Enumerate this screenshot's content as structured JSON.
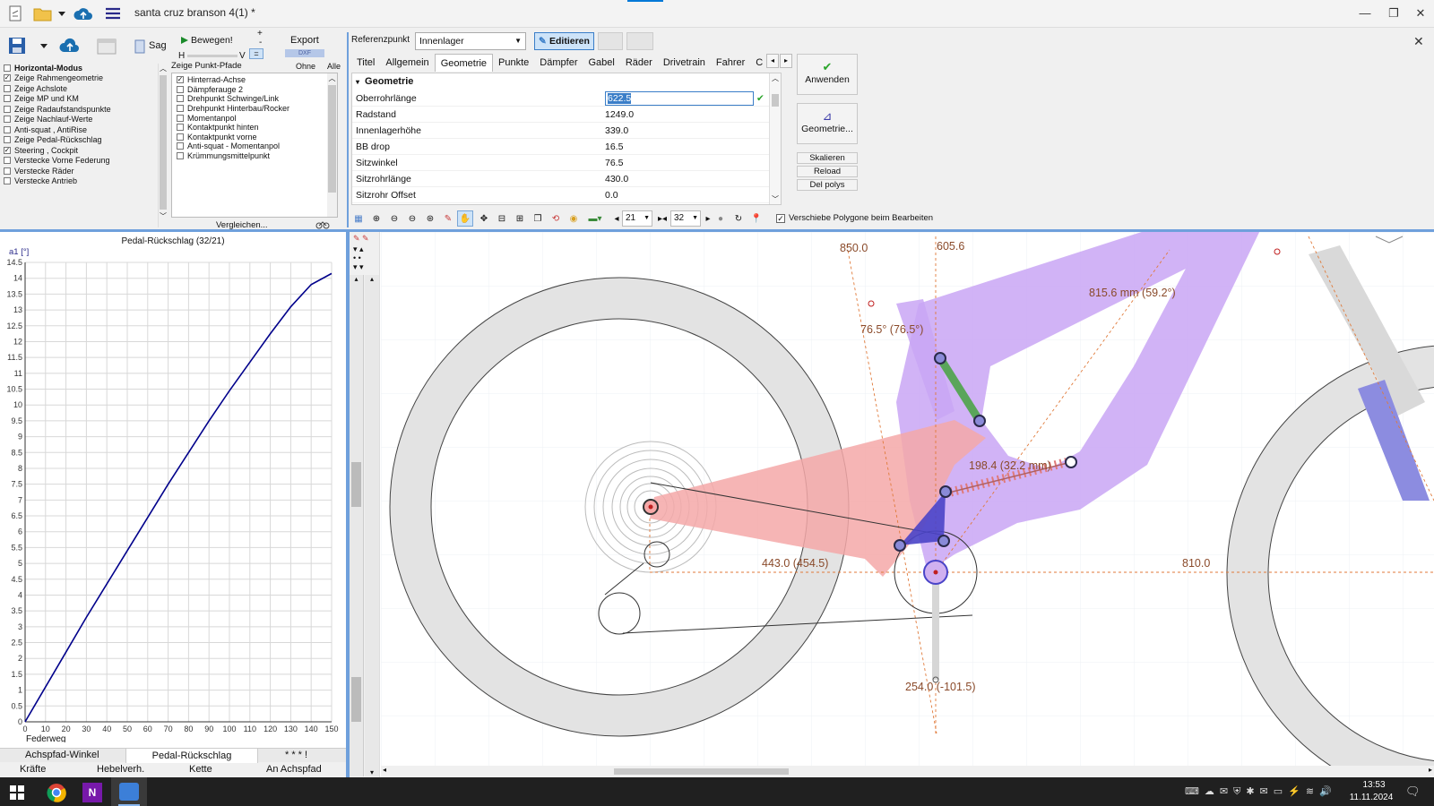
{
  "window": {
    "title": "santa cruz branson 4(1) *"
  },
  "toolbar": {
    "sag": "Sag",
    "move": "Bewegen!",
    "h": "H",
    "v": "V",
    "plus": "+",
    "minus": "-",
    "eq": "=",
    "export": "Export",
    "dxf": "DXF"
  },
  "options": {
    "items": [
      {
        "label": "Horizontal-Modus",
        "checked": false,
        "bold": true
      },
      {
        "label": "Zeige Rahmengeometrie",
        "checked": true
      },
      {
        "label": "Zeige Achslote",
        "checked": false
      },
      {
        "label": "Zeige MP und KM",
        "checked": false
      },
      {
        "label": "Zeige Radaufstandspunkte",
        "checked": false
      },
      {
        "label": "Zeige Nachlauf-Werte",
        "checked": false
      },
      {
        "label": "Anti-squat , AntiRise",
        "checked": false
      },
      {
        "label": "Zeige Pedal-Rückschlag",
        "checked": false
      },
      {
        "label": "Steering ,  Cockpit",
        "checked": true
      },
      {
        "label": "Verstecke Vorne Federung",
        "checked": false
      },
      {
        "label": "Verstecke Räder",
        "checked": false
      },
      {
        "label": "Verstecke Antrieb",
        "checked": false
      }
    ]
  },
  "paths": {
    "header": "Zeige Punkt-Pfade",
    "none": "Ohne",
    "all": "Alle",
    "compare": "Vergleichen...",
    "items": [
      {
        "label": "Hinterrad-Achse",
        "checked": true
      },
      {
        "label": "Dämpferauge 2",
        "checked": false
      },
      {
        "label": "Drehpunkt Schwinge/Link",
        "checked": false
      },
      {
        "label": "Drehpunkt Hinterbau/Rocker",
        "checked": false
      },
      {
        "label": "Momentanpol",
        "checked": false
      },
      {
        "label": "Kontaktpunkt hinten",
        "checked": false
      },
      {
        "label": "Kontaktpunkt vorne",
        "checked": false
      },
      {
        "label": "Anti-squat - Momentanpol",
        "checked": false
      },
      {
        "label": "Krümmungsmittelpunkt",
        "checked": false
      }
    ]
  },
  "ref": {
    "label": "Referenzpunkt",
    "value": "Innenlager",
    "edit": "Editieren"
  },
  "tabs": [
    "Titel",
    "Allgemein",
    "Geometrie",
    "Punkte",
    "Dämpfer",
    "Gabel",
    "Räder",
    "Drivetrain",
    "Fahrer",
    "C"
  ],
  "active_tab": "Geometrie",
  "geometry": {
    "section": "Geometrie",
    "rows": [
      {
        "key": "Oberrohrlänge",
        "value": "622.5"
      },
      {
        "key": "Radstand",
        "value": "1249.0"
      },
      {
        "key": "Innenlagerhöhe",
        "value": "339.0"
      },
      {
        "key": "BB drop",
        "value": "16.5"
      },
      {
        "key": "Sitzwinkel",
        "value": "76.5"
      },
      {
        "key": "Sitzrohrlänge",
        "value": "430.0"
      },
      {
        "key": "Sitzrohr Offset",
        "value": "0.0"
      }
    ]
  },
  "actions": {
    "apply": "Anwenden",
    "geometry": "Geometrie...",
    "scale": "Skalieren",
    "reload": "Reload",
    "del_polys": "Del polys"
  },
  "view_toolbar": {
    "sel1": "21",
    "sel2": "32",
    "shift_polygons": "Verschiebe Polygone beim Bearbeiten"
  },
  "chart": {
    "title": "Pedal-Rückschlag (32/21)",
    "ylabel": "a1 [°]",
    "xlabel": "Federweg",
    "tab_left": "Achspfad-Winkel",
    "tab_mid": "Pedal-Rückschlag",
    "tab_right": "* * * !",
    "bottom_tabs": [
      "Kräfte",
      "Hebelverh.",
      "Kette",
      "An Achspfad"
    ]
  },
  "chart_data": {
    "type": "line",
    "title": "Pedal-Rückschlag (32/21)",
    "xlabel": "Federweg",
    "ylabel": "a1 [°]",
    "xlim": [
      0,
      150
    ],
    "ylim": [
      0,
      14.5
    ],
    "xticks": [
      0,
      10,
      20,
      30,
      40,
      50,
      60,
      70,
      80,
      90,
      100,
      110,
      120,
      130,
      140,
      150
    ],
    "yticks": [
      0,
      0.5,
      1,
      1.5,
      2,
      2.5,
      3,
      3.5,
      4,
      4.5,
      5,
      5.5,
      6,
      6.5,
      7,
      7.5,
      8,
      8.5,
      9,
      9.5,
      10,
      10.5,
      11,
      11.5,
      12,
      12.5,
      13,
      13.5,
      14,
      14.5
    ],
    "grid": true,
    "series": [
      {
        "x": [
          0,
          10,
          20,
          30,
          40,
          50,
          60,
          70,
          80,
          90,
          100,
          110,
          120,
          130,
          140,
          150
        ],
        "y": [
          0,
          1.1,
          2.2,
          3.3,
          4.35,
          5.4,
          6.45,
          7.5,
          8.5,
          9.5,
          10.45,
          11.35,
          12.25,
          13.1,
          13.8,
          14.15
        ]
      }
    ]
  },
  "drawing": {
    "dim_850": "850.0",
    "dim_605": "605.6",
    "dim_815": "815.6 mm (59.2°)",
    "dim_angle": "76.5° (76.5°)",
    "dim_198": "198.4 (32.2 mm)",
    "dim_443": "443.0 (454.5)",
    "dim_810": "810.0",
    "dim_254": "254.0 (-101.5)"
  },
  "taskbar": {
    "time": "13:53",
    "date": "11.11.2024"
  },
  "colors": {
    "accent": "#0078d7",
    "frame_purple": "#c9a6f5",
    "swingarm_red": "#f5a8a8",
    "link_green": "#5aa55a",
    "link_blue": "#4a44c8",
    "curve": "#00008b"
  }
}
